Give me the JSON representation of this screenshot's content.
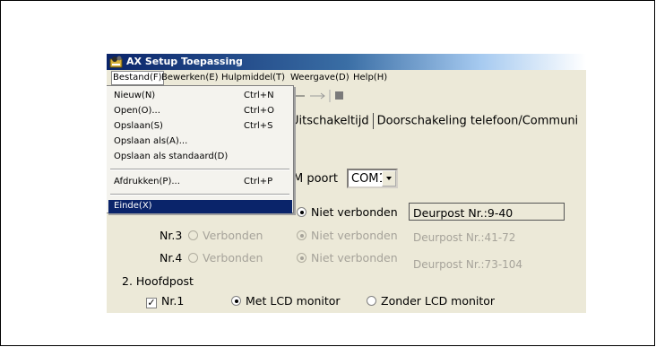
{
  "window": {
    "title": "AX Setup Toepassing"
  },
  "menubar": [
    "Bestand(F)",
    "Bewerken(E)",
    "Hulpmiddel(T)",
    "Weergave(D)",
    "Help(H)"
  ],
  "file_menu": {
    "items": [
      {
        "label": "Nieuw(N)",
        "shortcut": "Ctrl+N"
      },
      {
        "label": "Open(O)...",
        "shortcut": "Ctrl+O"
      },
      {
        "label": "Opslaan(S)",
        "shortcut": "Ctrl+S"
      },
      {
        "label": "Opslaan als(A)...",
        "shortcut": ""
      },
      {
        "label": "Opslaan als standaard(D)",
        "shortcut": ""
      },
      {
        "label": "Afdrukken(P)...",
        "shortcut": "Ctrl+P"
      },
      {
        "label": "Einde(X)",
        "shortcut": ""
      }
    ],
    "highlighted": "Einde(X)"
  },
  "tabs": {
    "label_1": "Uitschakeltijd",
    "label_2": "Doorschakeling telefoon/Communi"
  },
  "com_port": {
    "label": "M poort",
    "value": "COM1"
  },
  "rows": [
    {
      "nr": "",
      "opt1": "",
      "opt2": "Niet verbonden",
      "deurpost": "Deurpost Nr.:9-40",
      "enabled": true
    },
    {
      "nr": "Nr.3",
      "opt1": "Verbonden",
      "opt2": "Niet verbonden",
      "deurpost": "Deurpost Nr.:41-72",
      "enabled": false
    },
    {
      "nr": "Nr.4",
      "opt1": "Verbonden",
      "opt2": "Niet verbonden",
      "deurpost": "Deurpost Nr.:73-104",
      "enabled": false
    }
  ],
  "hoofdpost": {
    "heading": "2. Hoofdpost",
    "nr": "Nr.1",
    "opt_lcd": "Met LCD monitor",
    "opt_no_lcd": "Zonder LCD monitor"
  }
}
